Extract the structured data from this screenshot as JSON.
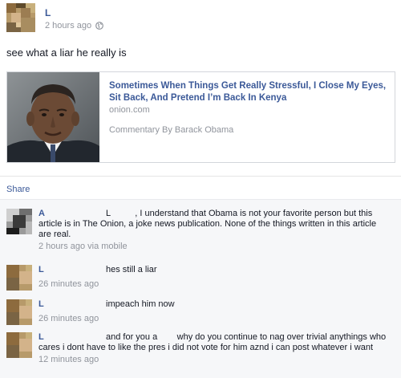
{
  "post": {
    "author": "L",
    "timestamp": "2 hours ago",
    "privacy_icon": "globe-icon",
    "text": "see what a liar he really is"
  },
  "link_card": {
    "title": "Sometimes When Things Get Really Stressful, I Close My Eyes, Sit Back, And Pretend I’m Back In Kenya",
    "domain": "onion.com",
    "caption": "Commentary By Barack Obama"
  },
  "actions": {
    "share_label": "Share"
  },
  "comments": [
    {
      "author": "A",
      "text": "L          , I understand that Obama is not your favorite person but this article is in The Onion, a joke news publication. None of the things written in this article are real.",
      "meta": "2 hours ago via mobile"
    },
    {
      "author": "L",
      "text": "hes still a liar",
      "meta": "26 minutes ago"
    },
    {
      "author": "L",
      "text": "impeach him now",
      "meta": "26 minutes ago"
    },
    {
      "author": "L",
      "text": "and for you a        why do you continue to nag over trivial anythings who cares i dont have to like the pres i did not vote for him aznd i can post whatever i want",
      "meta": "12 minutes ago"
    }
  ],
  "colors": {
    "link_blue": "#3b5998",
    "meta_gray": "#90949c",
    "comment_bg": "#f6f7f9"
  }
}
